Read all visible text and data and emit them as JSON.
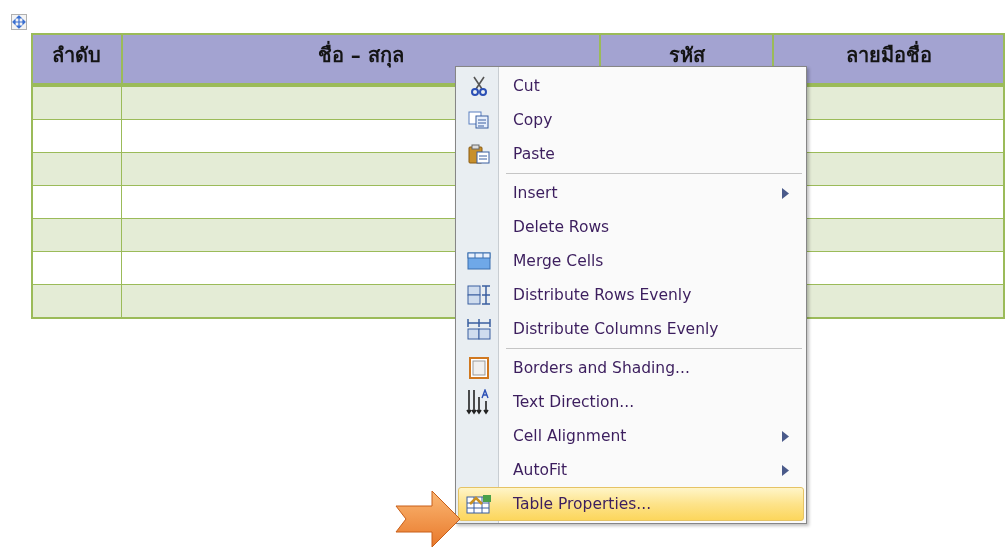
{
  "table": {
    "columns": [
      "ลำดับ",
      "ชื่อ – สกุล",
      "รหัส",
      "ลายมือชื่อ"
    ],
    "rows": [
      {
        "shaded": true
      },
      {
        "shaded": false
      },
      {
        "shaded": true
      },
      {
        "shaded": false
      },
      {
        "shaded": true
      },
      {
        "shaded": false
      },
      {
        "shaded": true
      }
    ]
  },
  "context_menu": {
    "groups": [
      [
        {
          "label": "Cut",
          "submenu": false,
          "selected": false
        },
        {
          "label": "Copy",
          "submenu": false,
          "selected": false
        },
        {
          "label": "Paste",
          "submenu": false,
          "selected": false
        }
      ],
      [
        {
          "label": "Insert",
          "submenu": true,
          "selected": false
        },
        {
          "label": "Delete Rows",
          "submenu": false,
          "selected": false
        },
        {
          "label": "Merge Cells",
          "submenu": false,
          "selected": false
        },
        {
          "label": "Distribute Rows Evenly",
          "submenu": false,
          "selected": false
        },
        {
          "label": "Distribute Columns Evenly",
          "submenu": false,
          "selected": false
        }
      ],
      [
        {
          "label": "Borders and Shading...",
          "submenu": false,
          "selected": false
        },
        {
          "label": "Text Direction...",
          "submenu": false,
          "selected": false
        },
        {
          "label": "Cell Alignment",
          "submenu": true,
          "selected": false
        },
        {
          "label": "AutoFit",
          "submenu": true,
          "selected": false
        },
        {
          "label": "Table Properties...",
          "submenu": false,
          "selected": true
        }
      ]
    ]
  }
}
